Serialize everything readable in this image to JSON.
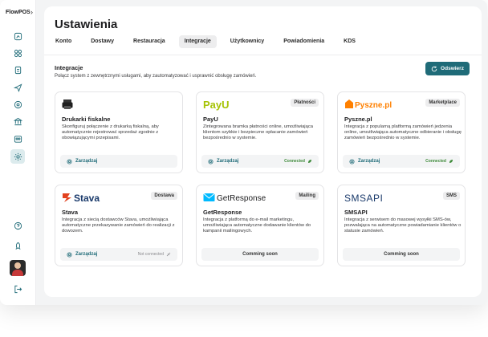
{
  "app": {
    "logo": "FlowPOS"
  },
  "header": {
    "title": "Ustawienia"
  },
  "tabs": [
    {
      "label": "Konto"
    },
    {
      "label": "Dostawy"
    },
    {
      "label": "Restauracja"
    },
    {
      "label": "Integracje"
    },
    {
      "label": "Użytkownicy"
    },
    {
      "label": "Powiadomienia"
    },
    {
      "label": "KDS"
    }
  ],
  "active_tab": "Integracje",
  "section": {
    "title": "Integracje",
    "description": "Połącz system z zewnętrznymi usługami, aby zautomatyzować i usprawnić obsługę zamówień.",
    "refresh_label": "Odswierz"
  },
  "colors": {
    "accent": "#1f6b78",
    "connected": "#3f8b3b",
    "payu": "#a6c307",
    "pyszne": "#ff8000",
    "stava": "#e2421f",
    "getresponse": "#00baff"
  },
  "cards": [
    {
      "logo": "printer-icon",
      "category": "",
      "name": "Drukarki fiskalne",
      "description": "Skonfiguruj połączenie z drukarką fiskalną, aby automatycznie rejestrować sprzedaż zgodnie z obowiązującymi przepisami.",
      "action": "Zarządzaj",
      "status": ""
    },
    {
      "logo": "PayU",
      "category": "Płatności",
      "name": "PayU",
      "description": "Zintegrowana bramka płatności online, umożliwiająca klientom szybkie i bezpieczne opłacanie zamówień bezpośrednio w systemie.",
      "action": "Zarządzaj",
      "status": "Connected"
    },
    {
      "logo": "Pyszne.pl",
      "category": "Marketplace",
      "name": "Pyszne.pl",
      "description": "Integracja z popularną platformą zamówień jedzenia online, umożliwiająca automatyczne odbieranie i obsługę zamówień bezpośrednio w systemie.",
      "action": "Zarządzaj",
      "status": "Connected"
    },
    {
      "logo": "Stava",
      "category": "Dostawa",
      "name": "Stava",
      "description": "Integracja z siecią dostawców Stava, umożliwiająca automatyczne przekazywanie zamówień do realizacji z dowozem.",
      "action": "Zarządzaj",
      "status": "Not connected"
    },
    {
      "logo": "GetResponse",
      "category": "Mailing",
      "name": "GetResponse",
      "description": "Integracja z platformą do e-mail marketingu, umożliwiająca automatyczne dodawanie klientów do kampanii mailingowych.",
      "action": "Comming soon",
      "status": ""
    },
    {
      "logo": "SMSAPI",
      "category": "SMS",
      "name": "SMSAPI",
      "description": "Integracja z serwisem do masowej wysyłki SMS-ów, pozwalająca na automatyczne powiadamianie klientów o statusie zamówień.",
      "action": "Comming soon",
      "status": ""
    }
  ],
  "sidebar": {
    "icons": [
      "dashboard-icon",
      "grid-icon",
      "orders-icon",
      "send-icon",
      "location-icon",
      "bank-icon",
      "team-icon",
      "settings-icon"
    ],
    "bottom_icons": [
      "help-icon",
      "rocket-icon",
      "logout-icon"
    ]
  }
}
